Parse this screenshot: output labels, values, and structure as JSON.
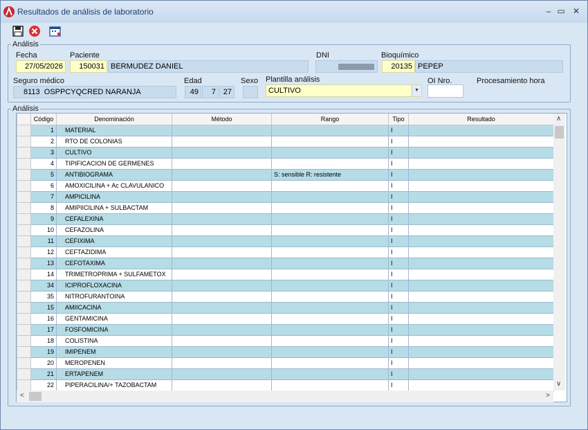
{
  "window": {
    "title": "Resultados de análisis de laboratorio",
    "controls": {
      "minimize": "–",
      "maximize": "▭",
      "close": "✕"
    }
  },
  "toolbar": {
    "buttons": [
      {
        "name": "save-icon",
        "tooltip": ""
      },
      {
        "name": "cancel-icon",
        "tooltip": ""
      },
      {
        "name": "calendar-icon",
        "tooltip": ""
      }
    ]
  },
  "analisis_header": {
    "legend": "Análisis",
    "fecha_label": "Fecha",
    "fecha_value": "27/05/2026",
    "paciente_label": "Paciente",
    "paciente_id": "150031",
    "paciente_nombre": "BERMUDEZ DANIEL",
    "dni_label": "DNI",
    "dni_value": "",
    "bioquimico_label": "Bioquímico",
    "bioquimico_id": "20135",
    "bioquimico_nombre": "PEPEP",
    "seguro_label": "Seguro médico",
    "seguro_id": "8113",
    "seguro_nombre": "OSPPCYQCRED NARANJA",
    "edad_label": "Edad",
    "edad_years": "49",
    "edad_months": "7",
    "edad_days": "27",
    "sexo_label": "Sexo",
    "sexo_value": "",
    "plantilla_label": "Plantilla análisis",
    "plantilla_value": "CULTIVO",
    "oi_label": "OI Nro.",
    "oi_value": "",
    "procesamiento_label": "Procesamiento hora"
  },
  "grid": {
    "legend": "Análisis",
    "columns": [
      "Código",
      "Denominación",
      "Método",
      "Rango",
      "Tipo",
      "Resultado"
    ],
    "rows": [
      {
        "codigo": "1",
        "denominacion": "MATERIAL",
        "metodo": "",
        "rango": "",
        "tipo": "I",
        "resultado": ""
      },
      {
        "codigo": "2",
        "denominacion": "RTO DE COLONIAS",
        "metodo": "",
        "rango": "",
        "tipo": "I",
        "resultado": ""
      },
      {
        "codigo": "3",
        "denominacion": "CULTIVO",
        "metodo": "",
        "rango": "",
        "tipo": "I",
        "resultado": ""
      },
      {
        "codigo": "4",
        "denominacion": "TIPIFICACION DE GERMENES",
        "metodo": "",
        "rango": "",
        "tipo": "I",
        "resultado": ""
      },
      {
        "codigo": "5",
        "denominacion": "ANTIBIOGRAMA",
        "metodo": "",
        "rango": "S: sensible    R: resistente",
        "tipo": "I",
        "resultado": ""
      },
      {
        "codigo": "6",
        "denominacion": "AMOXICILINA + Ac CLAVULANICO",
        "metodo": "",
        "rango": "",
        "tipo": "I",
        "resultado": ""
      },
      {
        "codigo": "7",
        "denominacion": "AMPICILINA",
        "metodo": "",
        "rango": "",
        "tipo": "I",
        "resultado": ""
      },
      {
        "codigo": "8",
        "denominacion": "AMIPIICILINA + SULBACTAM",
        "metodo": "",
        "rango": "",
        "tipo": "I",
        "resultado": ""
      },
      {
        "codigo": "9",
        "denominacion": "CEFALEXINA",
        "metodo": "",
        "rango": "",
        "tipo": "I",
        "resultado": ""
      },
      {
        "codigo": "10",
        "denominacion": "CEFAZOLINA",
        "metodo": "",
        "rango": "",
        "tipo": "I",
        "resultado": ""
      },
      {
        "codigo": "11",
        "denominacion": " CEFIXIMA",
        "metodo": "",
        "rango": "",
        "tipo": "I",
        "resultado": ""
      },
      {
        "codigo": "12",
        "denominacion": "CEFTAZIDIMA",
        "metodo": "",
        "rango": "",
        "tipo": "I",
        "resultado": ""
      },
      {
        "codigo": "13",
        "denominacion": "CEFOTAXIMA",
        "metodo": "",
        "rango": "",
        "tipo": "I",
        "resultado": ""
      },
      {
        "codigo": "14",
        "denominacion": "TRIMETROPRIMA + SULFAMETOX",
        "metodo": "",
        "rango": "",
        "tipo": "I",
        "resultado": ""
      },
      {
        "codigo": "34",
        "denominacion": "ICIPROFLOXACINA",
        "metodo": "",
        "rango": "",
        "tipo": "I",
        "resultado": ""
      },
      {
        "codigo": "35",
        "denominacion": "NITROFURANTOINA",
        "metodo": "",
        "rango": "",
        "tipo": "I",
        "resultado": ""
      },
      {
        "codigo": "15",
        "denominacion": "AMIICACINA",
        "metodo": "",
        "rango": "",
        "tipo": "I",
        "resultado": ""
      },
      {
        "codigo": "16",
        "denominacion": "GENTAMICINA",
        "metodo": "",
        "rango": "",
        "tipo": "I",
        "resultado": ""
      },
      {
        "codigo": "17",
        "denominacion": "FOSFOMICINA",
        "metodo": "",
        "rango": "",
        "tipo": "I",
        "resultado": ""
      },
      {
        "codigo": "18",
        "denominacion": "COLISTINA",
        "metodo": "",
        "rango": "",
        "tipo": "I",
        "resultado": ""
      },
      {
        "codigo": "19",
        "denominacion": "IMIPENEM",
        "metodo": "",
        "rango": "",
        "tipo": "I",
        "resultado": ""
      },
      {
        "codigo": "20",
        "denominacion": "MEROPENEN",
        "metodo": "",
        "rango": "",
        "tipo": "I",
        "resultado": ""
      },
      {
        "codigo": "21",
        "denominacion": "ERTAPENEM",
        "metodo": "",
        "rango": "",
        "tipo": "I",
        "resultado": ""
      },
      {
        "codigo": "22",
        "denominacion": "PIPERACILINA/+ TAZOBACTAM",
        "metodo": "",
        "rango": "",
        "tipo": "I",
        "resultado": ""
      }
    ]
  },
  "scrollbars": {
    "up": "∧",
    "down": "∨",
    "left": "<",
    "right": ">"
  },
  "colors": {
    "row_alt": "#b6dce5",
    "field_yellow": "#ffffc8",
    "field_blue": "#c9dcee",
    "window_bg": "#d9e6f4"
  }
}
